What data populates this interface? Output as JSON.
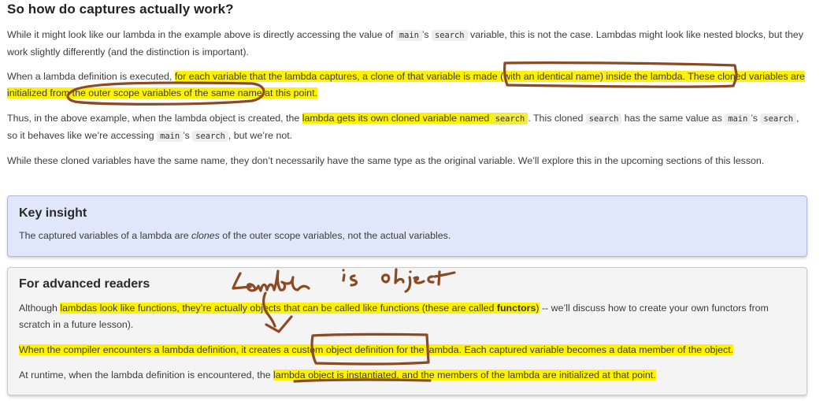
{
  "heading": "So how do captures actually work?",
  "p1": {
    "a": "While it might look like our lambda in the example above is directly accessing the value of ",
    "c1": "main",
    "b": "’s ",
    "c2": "search",
    "d": " variable, this is not the case. Lambdas might look like nested blocks, but they work slightly differently (and the distinction is important)."
  },
  "p2": {
    "a": "When a lambda definition is executed, ",
    "hl": "for each variable that the lambda captures, a clone of that variable is made (with an identical name) inside the lambda. These cloned variables are initialized from the outer scope variables of the same name at this point."
  },
  "p3": {
    "a": "Thus, in the above example, when the lambda object is created, the ",
    "hl": "lambda gets its own cloned variable named ",
    "c1": "search",
    "b": ". This cloned ",
    "c2": "search",
    "c": " has the same value as ",
    "c3": "main",
    "d": "’s ",
    "c4": "search",
    "e": ", so it behaves like we’re accessing ",
    "c5": "main",
    "f": "’s ",
    "c6": "search",
    "g": ", but we’re not."
  },
  "p4": "While these cloned variables have the same name, they don’t necessarily have the same type as the original variable. We’ll explore this in the upcoming sections of this lesson.",
  "insight": {
    "title": "Key insight",
    "a": "The captured variables of a lambda are ",
    "em": "clones",
    "b": " of the outer scope variables, not the actual variables."
  },
  "advanced": {
    "title": "For advanced readers",
    "p1": {
      "a": "Although ",
      "hl": "lambdas look like functions, they’re actually objects that can be called like functions (these are called ",
      "strong": "functors",
      "hl2": ")",
      "b": " -- we’ll discuss how to create your own functors from scratch in a future lesson)."
    },
    "p2": "When the compiler encounters a lambda definition, it creates a custom object definition for the lambda. Each captured variable becomes a data member of the object.",
    "p3": {
      "a": "At runtime, when the lambda definition is encountered, the ",
      "hl": "lambda object is instantiated, and the members of the lambda are initialized at that point."
    }
  },
  "handwritten_note": "Lambda is object",
  "colors": {
    "highlight": "#fff200",
    "ink": "#8b4a24",
    "insight_bg": "#e1e7fb",
    "insight_border": "#a9b8e6",
    "advanced_bg": "#f4f4f4"
  }
}
